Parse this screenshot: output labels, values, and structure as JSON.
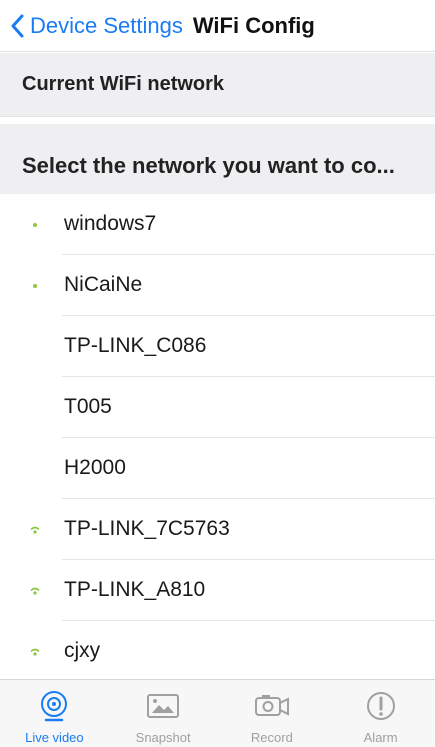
{
  "nav": {
    "back_label": "Device Settings",
    "title": "WiFi Config"
  },
  "sections": {
    "current": "Current WiFi network",
    "select": "Select the network you want to co..."
  },
  "networks": [
    {
      "name": "windows7",
      "signal": "dot"
    },
    {
      "name": "NiCaiNe",
      "signal": "dot"
    },
    {
      "name": "TP-LINK_C086",
      "signal": "none"
    },
    {
      "name": "T005",
      "signal": "none"
    },
    {
      "name": "H2000",
      "signal": "none"
    },
    {
      "name": "TP-LINK_7C5763",
      "signal": "wifi"
    },
    {
      "name": "TP-LINK_A810",
      "signal": "wifi"
    },
    {
      "name": "cjxy",
      "signal": "wifi"
    }
  ],
  "tabs": [
    {
      "label": "Live video",
      "icon": "live-video-icon",
      "active": true
    },
    {
      "label": "Snapshot",
      "icon": "snapshot-icon",
      "active": false
    },
    {
      "label": "Record",
      "icon": "record-icon",
      "active": false
    },
    {
      "label": "Alarm",
      "icon": "alarm-icon",
      "active": false
    }
  ],
  "colors": {
    "accent": "#1a7cf3",
    "signal": "#8cc63f",
    "section_bg": "#efeff2",
    "inactive": "#a0a0a0"
  }
}
